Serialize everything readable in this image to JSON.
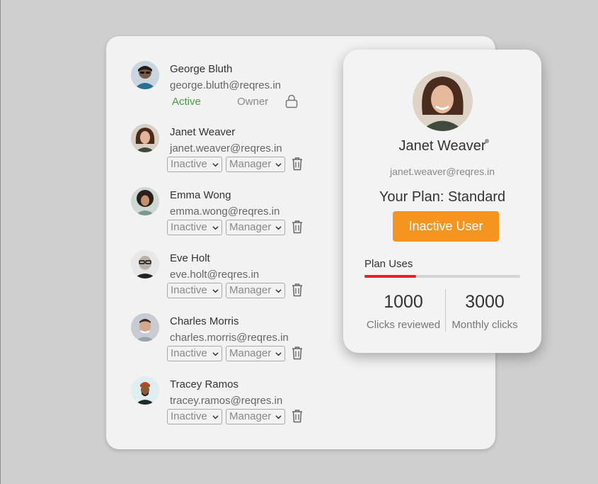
{
  "users": [
    {
      "name": "George Bluth",
      "email": "george.bluth@reqres.in",
      "status": "Active",
      "role": "Owner",
      "avatar": "george-bluth-avatar",
      "editable": false
    },
    {
      "name": "Janet Weaver",
      "email": "janet.weaver@reqres.in",
      "status": "Inactive",
      "role": "Manager",
      "avatar": "janet-weaver-avatar",
      "editable": true
    },
    {
      "name": "Emma Wong",
      "email": "emma.wong@reqres.in",
      "status": "Inactive",
      "role": "Manager",
      "avatar": "emma-wong-avatar",
      "editable": true
    },
    {
      "name": "Eve Holt",
      "email": "eve.holt@reqres.in",
      "status": "Inactive",
      "role": "Manager",
      "avatar": "eve-holt-avatar",
      "editable": true
    },
    {
      "name": "Charles Morris",
      "email": "charles.morris@reqres.in",
      "status": "Inactive",
      "role": "Manager",
      "avatar": "charles-morris-avatar",
      "editable": true
    },
    {
      "name": "Tracey Ramos",
      "email": "tracey.ramos@reqres.in",
      "status": "Inactive",
      "role": "Manager",
      "avatar": "tracey-ramos-avatar",
      "editable": true
    }
  ],
  "profile": {
    "name": "Janet Weaver",
    "email": "janet.weaver@reqres.in",
    "plan": "Your Plan: Standard",
    "button": "Inactive User",
    "uses_label": "Plan Uses",
    "uses_fraction": 0.33,
    "stats": [
      {
        "value": "1000",
        "label": "Clicks reviewed"
      },
      {
        "value": "3000",
        "label": "Monthly clicks"
      }
    ]
  },
  "colors": {
    "active_status": "#4a9a3f",
    "button": "#f5951f",
    "progress": "#e5212d",
    "card": "#f2f2f2",
    "background": "#cfcfcf"
  },
  "icons": [
    "lock-icon",
    "trash-icon",
    "chevron-down-icon",
    "online-status-dot"
  ]
}
